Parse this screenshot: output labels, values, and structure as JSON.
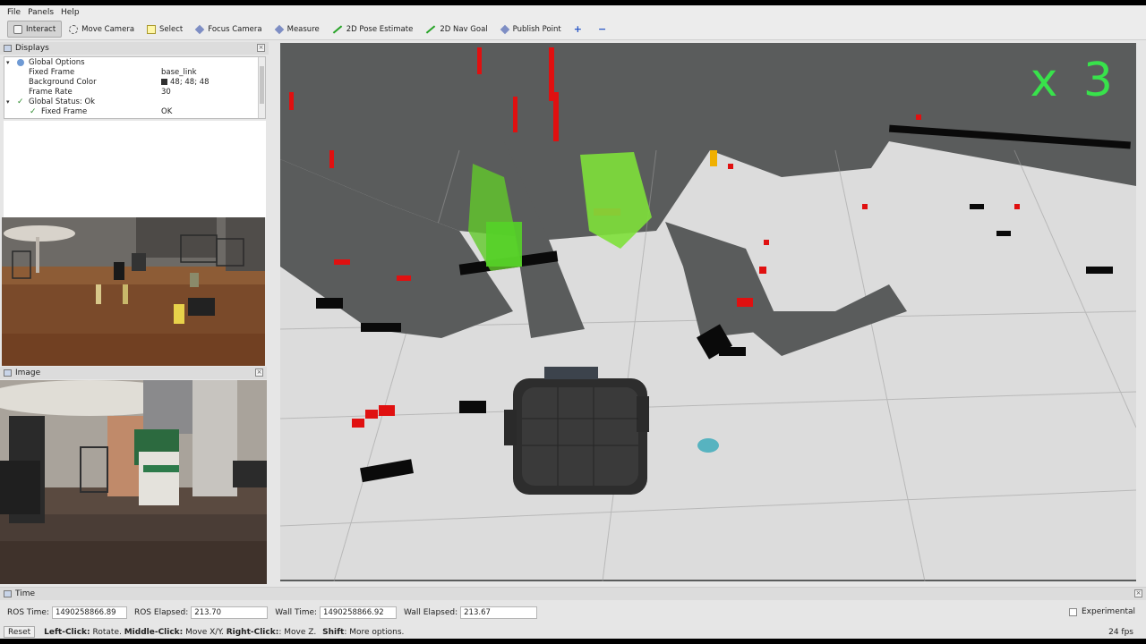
{
  "menubar": {
    "items": [
      "File",
      "Panels",
      "Help"
    ]
  },
  "toolbar": {
    "tools": [
      {
        "label": "Interact",
        "icon": "hand-icon"
      },
      {
        "label": "Move Camera",
        "icon": "move-camera-icon"
      },
      {
        "label": "Select",
        "icon": "select-icon"
      },
      {
        "label": "Focus Camera",
        "icon": "focus-camera-icon"
      },
      {
        "label": "Measure",
        "icon": "measure-icon"
      },
      {
        "label": "2D Pose Estimate",
        "icon": "pose-arrow-icon"
      },
      {
        "label": "2D Nav Goal",
        "icon": "nav-goal-arrow-icon"
      },
      {
        "label": "Publish Point",
        "icon": "publish-point-icon"
      }
    ],
    "add_icon": "+",
    "remove_icon": "−"
  },
  "displays": {
    "title": "Displays",
    "rows": [
      {
        "label": "Global Options",
        "value": ""
      },
      {
        "label": "Fixed Frame",
        "value": "base_link"
      },
      {
        "label": "Background Color",
        "value": "48; 48; 48"
      },
      {
        "label": "Frame Rate",
        "value": "30"
      },
      {
        "label": "Global Status: Ok",
        "value": ""
      },
      {
        "label": "Fixed Frame",
        "value": "OK"
      }
    ]
  },
  "image_panel": {
    "title": "Image"
  },
  "view3d": {
    "overlay_text": "x 3"
  },
  "time_panel": {
    "title": "Time",
    "ros_time_label": "ROS Time:",
    "ros_time": "1490258866.89",
    "ros_elapsed_label": "ROS Elapsed:",
    "ros_elapsed": "213.70",
    "wall_time_label": "Wall Time:",
    "wall_time": "1490258866.92",
    "wall_elapsed_label": "Wall Elapsed:",
    "wall_elapsed": "213.67",
    "experimental_label": "Experimental"
  },
  "status": {
    "reset_label": "Reset",
    "hint_left_key": "Left-Click:",
    "hint_left": " Rotate. ",
    "hint_middle_key": "Middle-Click:",
    "hint_middle": " Move X/Y. ",
    "hint_right_key": "Right-Click:",
    "hint_right": ": Move Z. ",
    "hint_shift_key": "Shift",
    "hint_shift": ": More options.",
    "fps": "24 fps"
  },
  "colors": {
    "grid_free": "#dcdcdc",
    "grid_unknown": "#5a5c5c",
    "grid_occupied": "#000000",
    "laser": "#e01010",
    "pointcloud": "#7ee03a",
    "speed_overlay": "#38e24b"
  }
}
